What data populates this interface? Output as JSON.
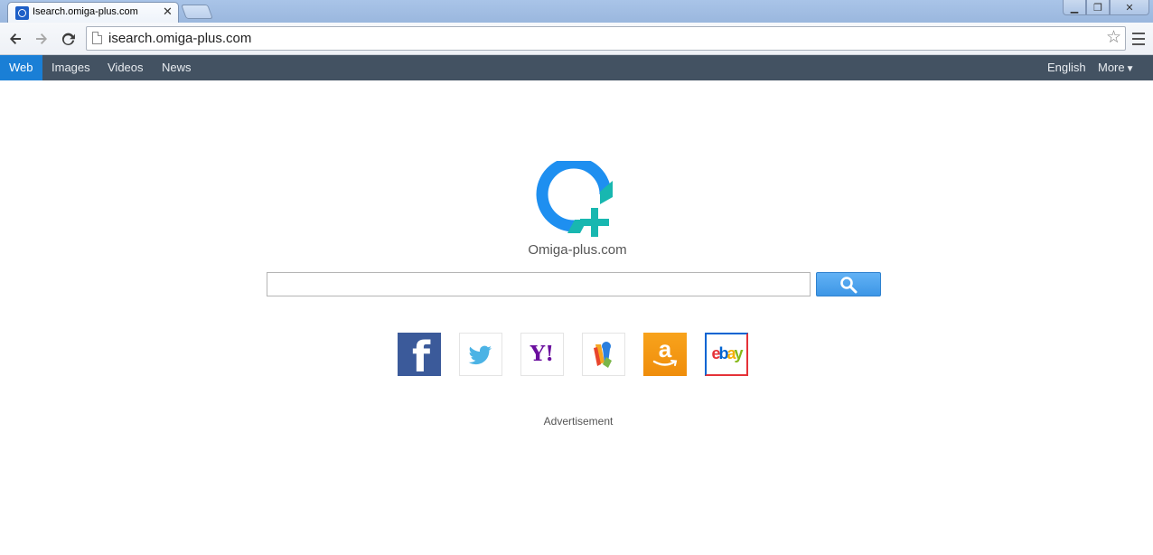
{
  "browser": {
    "tab_title": "Isearch.omiga-plus.com",
    "tab_close": "✕",
    "url": "isearch.omiga-plus.com",
    "window_buttons": {
      "minimize": "▁",
      "restore": "❐",
      "close": "✕"
    }
  },
  "site_nav": {
    "left_items": [
      "Web",
      "Images",
      "Videos",
      "News"
    ],
    "active_item": "Web",
    "language": "English",
    "more_label": "More",
    "more_caret": "▼"
  },
  "logo": {
    "text": "Omiga-plus.com",
    "colors": {
      "ring": "#1e8ff0",
      "plus": "#18b7b0"
    }
  },
  "search": {
    "value": "",
    "button_icon": "search-icon"
  },
  "shortcuts": [
    {
      "name": "facebook",
      "icon": "facebook-icon",
      "glyph": "f",
      "color": "#3b5a9a"
    },
    {
      "name": "twitter",
      "icon": "twitter-icon",
      "color": "#4bb3e5"
    },
    {
      "name": "yahoo",
      "icon": "yahoo-icon",
      "glyph": "Y!",
      "color": "#6b0f9e"
    },
    {
      "name": "bing-maps",
      "icon": "maps-pin-icon"
    },
    {
      "name": "amazon",
      "icon": "amazon-icon",
      "glyph": "a",
      "color": "#ef8d0b"
    },
    {
      "name": "ebay",
      "icon": "ebay-icon",
      "glyph_parts": [
        "e",
        "b",
        "a",
        "y"
      ]
    }
  ],
  "advertisement_label": "Advertisement",
  "colors": {
    "nav_bg": "#435262",
    "nav_active": "#1a7fd6",
    "search_button": "#3d96e6"
  }
}
